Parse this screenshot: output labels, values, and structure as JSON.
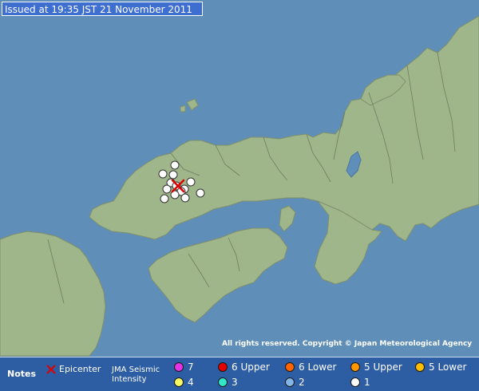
{
  "header": {
    "issued_label": "Issued at 19:35 JST  21 November 2011"
  },
  "map": {
    "copyright": "All rights reserved. Copyright © Japan Meteorological Agency",
    "sea_color": "#5f8fb8",
    "land_color": "#9fb58a"
  },
  "legend": {
    "notes_label": "Notes",
    "epicenter_label": "Epicenter",
    "jma_label_line1": "JMA Seismic",
    "jma_label_line2": "Intensity",
    "intensities": [
      {
        "label": "7",
        "color": "#e632e6"
      },
      {
        "label": "6 Upper",
        "color": "#e60000"
      },
      {
        "label": "6 Lower",
        "color": "#ff6400"
      },
      {
        "label": "5 Upper",
        "color": "#ff9600"
      },
      {
        "label": "5 Lower",
        "color": "#ffbe00"
      },
      {
        "label": "4",
        "color": "#fafa64"
      },
      {
        "label": "3",
        "color": "#32e6c8"
      },
      {
        "label": "2",
        "color": "#82b4e6"
      },
      {
        "label": "1",
        "color": "#ffffff"
      }
    ]
  },
  "observations": {
    "intensity": "1",
    "station_count": 13
  }
}
